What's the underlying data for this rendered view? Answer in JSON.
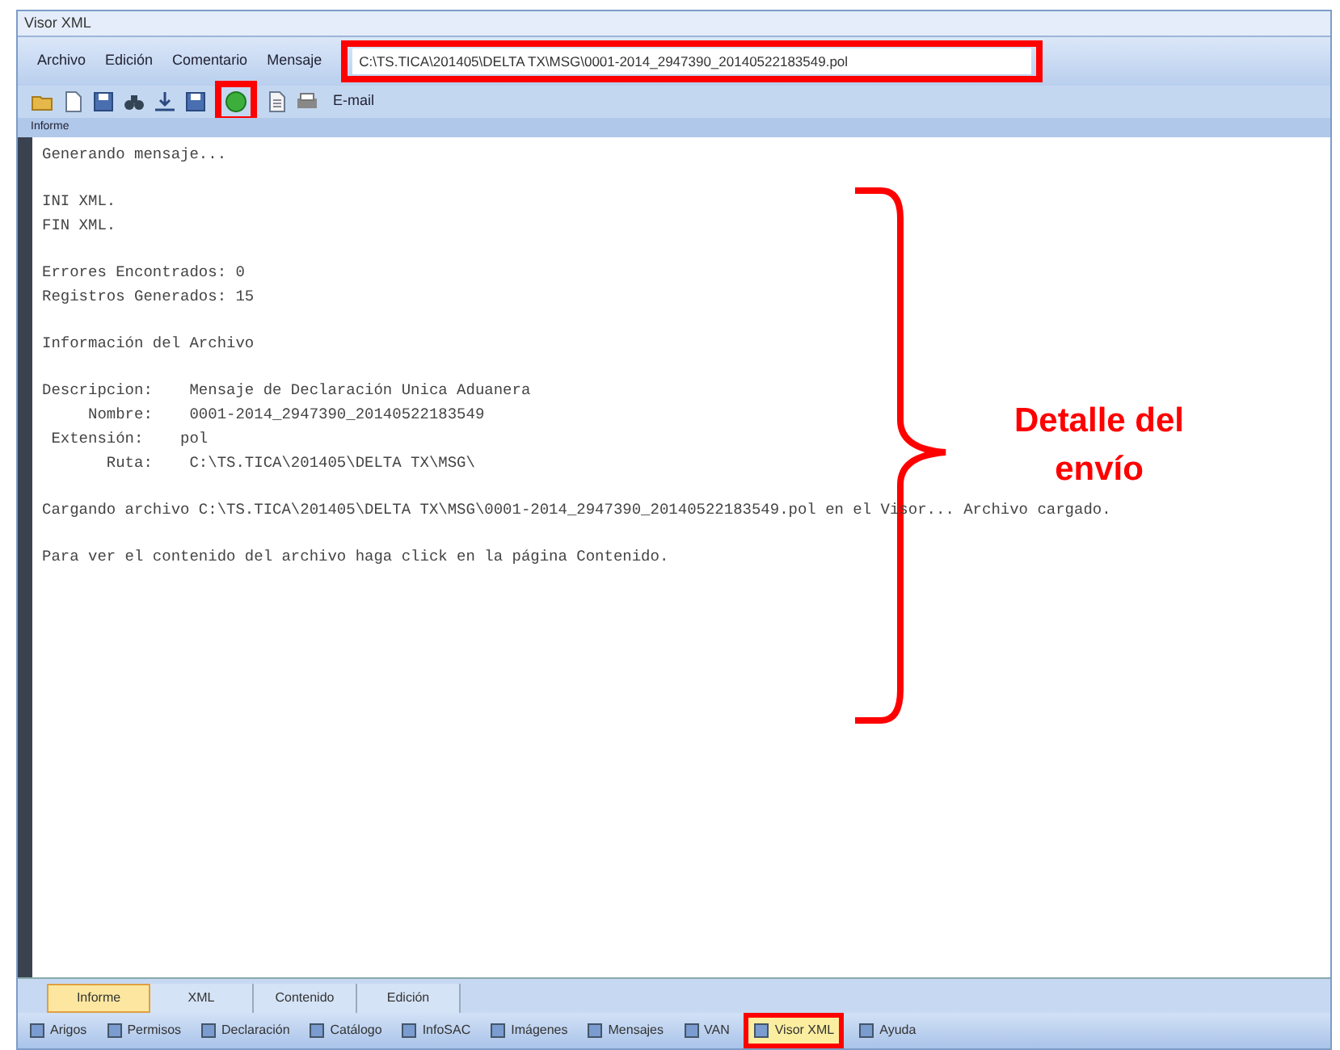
{
  "window": {
    "title": "Visor XML"
  },
  "menu": [
    {
      "label": "Archivo"
    },
    {
      "label": "Edición"
    },
    {
      "label": "Comentario"
    },
    {
      "label": "Mensaje"
    }
  ],
  "path_field": {
    "value": "C:\\TS.TICA\\201405\\DELTA TX\\MSG\\0001-2014_2947390_20140522183549.pol",
    "highlighted": true
  },
  "toolbar": [
    {
      "kind": "open",
      "highlighted": false
    },
    {
      "kind": "new",
      "highlighted": false
    },
    {
      "kind": "save",
      "highlighted": false
    },
    {
      "kind": "find",
      "highlighted": false
    },
    {
      "kind": "import",
      "highlighted": false
    },
    {
      "kind": "save",
      "highlighted": false
    },
    {
      "kind": "globe",
      "highlighted": true
    },
    {
      "kind": "page",
      "highlighted": false
    },
    {
      "kind": "print",
      "highlighted": false
    }
  ],
  "email_button": {
    "label": "E-mail"
  },
  "panel_label": "Informe",
  "report": [
    [
      "Generando mensaje..."
    ],
    [
      "INI XML.",
      "FIN XML."
    ],
    [
      "Errores Encontrados: 0",
      "Registros Generados: 15"
    ],
    [
      "Información del Archivo"
    ],
    [
      "Descripcion:    Mensaje de Declaración Unica Aduanera",
      "     Nombre:    0001-2014_2947390_20140522183549",
      " Extensión:    pol",
      "       Ruta:    C:\\TS.TICA\\201405\\DELTA TX\\MSG\\"
    ],
    [
      "Cargando archivo C:\\TS.TICA\\201405\\DELTA TX\\MSG\\0001-2014_2947390_20140522183549.pol en el Visor... Archivo cargado."
    ],
    [
      "Para ver el contenido del archivo haga click en la página Contenido."
    ]
  ],
  "annotation": {
    "text": "Detalle del envío"
  },
  "tabs": [
    {
      "label": "Informe",
      "selected": true
    },
    {
      "label": "XML",
      "selected": false
    },
    {
      "label": "Contenido",
      "selected": false
    },
    {
      "label": "Edición",
      "selected": false
    }
  ],
  "taskbar": [
    {
      "label": "Arigos",
      "selected": false
    },
    {
      "label": "Permisos",
      "selected": false
    },
    {
      "label": "Declaración",
      "selected": false
    },
    {
      "label": "Catálogo",
      "selected": false
    },
    {
      "label": "InfoSAC",
      "selected": false
    },
    {
      "label": "Imágenes",
      "selected": false
    },
    {
      "label": "Mensajes",
      "selected": false
    },
    {
      "label": "VAN",
      "selected": false
    },
    {
      "label": "Visor XML",
      "selected": true
    },
    {
      "label": "Ayuda",
      "selected": false
    }
  ]
}
